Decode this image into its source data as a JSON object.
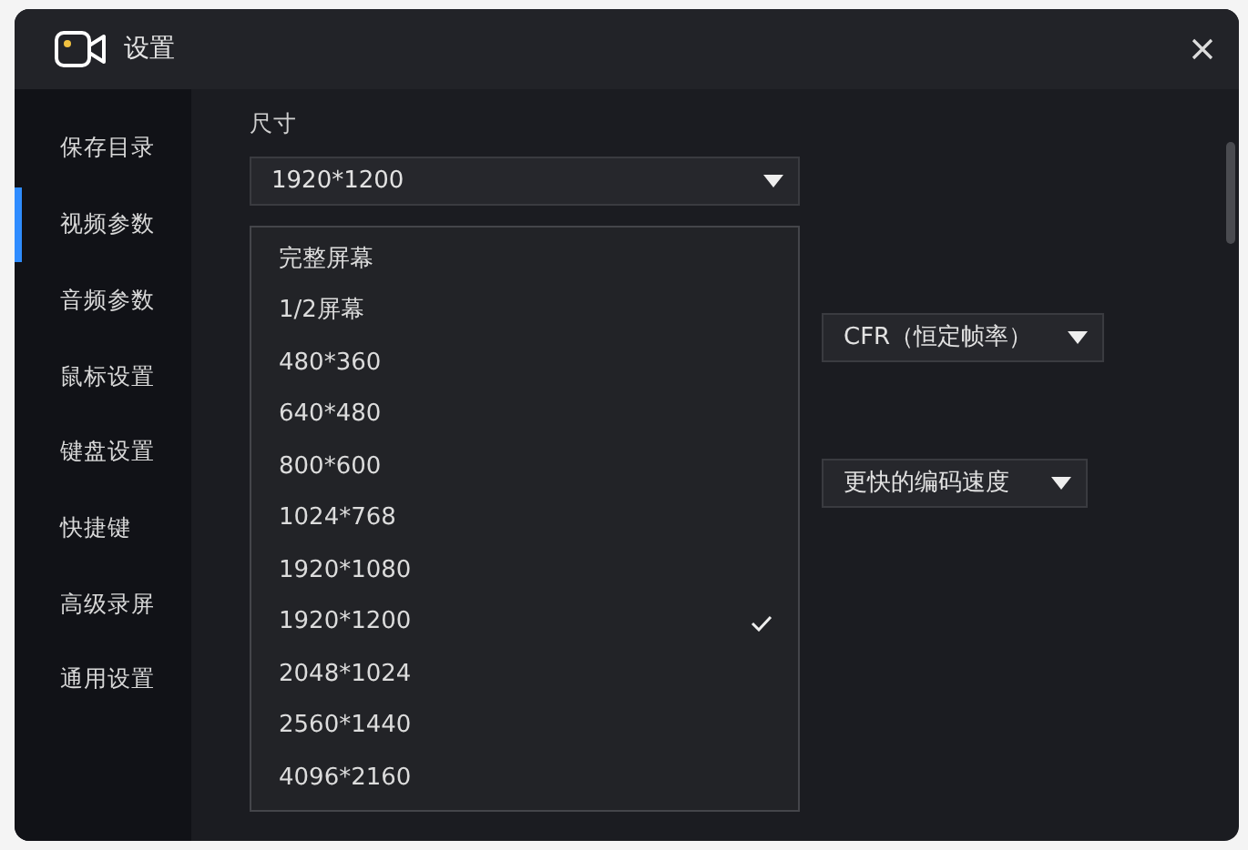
{
  "window": {
    "title": "设置"
  },
  "sidebar": {
    "items": [
      {
        "label": "保存目录",
        "selected": false
      },
      {
        "label": "视频参数",
        "selected": true
      },
      {
        "label": "音频参数",
        "selected": false
      },
      {
        "label": "鼠标设置",
        "selected": false
      },
      {
        "label": "键盘设置",
        "selected": false
      },
      {
        "label": "快捷键",
        "selected": false
      },
      {
        "label": "高级录屏",
        "selected": false
      },
      {
        "label": "通用设置",
        "selected": false
      }
    ]
  },
  "size_field": {
    "label": "尺寸",
    "value": "1920*1200",
    "expanded": true,
    "options": [
      {
        "label": "完整屏幕",
        "selected": false
      },
      {
        "label": "1/2屏幕",
        "selected": false
      },
      {
        "label": "480*360",
        "selected": false
      },
      {
        "label": "640*480",
        "selected": false
      },
      {
        "label": "800*600",
        "selected": false
      },
      {
        "label": "1024*768",
        "selected": false
      },
      {
        "label": "1920*1080",
        "selected": false
      },
      {
        "label": "1920*1200",
        "selected": true
      },
      {
        "label": "2048*1024",
        "selected": false
      },
      {
        "label": "2560*1440",
        "selected": false
      },
      {
        "label": "4096*2160",
        "selected": false
      }
    ]
  },
  "frame_rate_mode": {
    "value": "CFR（恒定帧率）"
  },
  "encoder_preset": {
    "value": "更快的编码速度"
  }
}
